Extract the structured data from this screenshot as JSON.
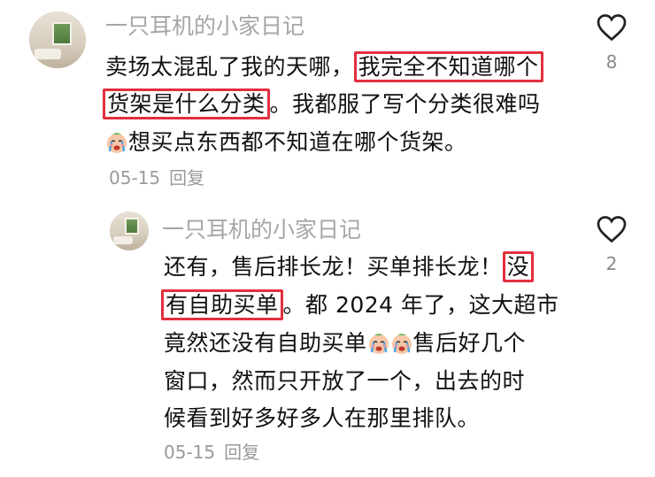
{
  "comments": [
    {
      "username": "一只耳机的小家日记",
      "lines": [
        {
          "pre": "卖场太混乱了我的天哪，",
          "hl": "我完全不知道哪个"
        },
        {
          "hl": "货架是什么分类",
          "post": "。我都服了写个分类很难吗"
        },
        {
          "emoji": "crying-face-emoji",
          "post": "想买点东西都不知道在哪个货架。"
        }
      ],
      "date": "05-15",
      "reply_label": "回复",
      "like_count": "8"
    },
    {
      "username": "一只耳机的小家日记",
      "lines": [
        {
          "pre": "还有，售后排长龙！买单排长龙！",
          "hl": "没"
        },
        {
          "hl": "有自助买单",
          "post": "。都 2024 年了，这大超市"
        },
        {
          "pre": "竟然还没有自助买单",
          "emoji_count": 2,
          "post": "售后好几个"
        },
        {
          "pre": "窗口，然而只开放了一个，出去的时"
        },
        {
          "pre": "候看到好多好多人在那里排队。"
        }
      ],
      "date": "05-15",
      "reply_label": "回复",
      "like_count": "2"
    }
  ],
  "icons": {
    "like": "heart-outline-icon",
    "emoji": "crying-face-emoji"
  },
  "colors": {
    "highlight": "#e2303d",
    "username": "#a6a6a6",
    "meta": "#9a9a9a"
  }
}
